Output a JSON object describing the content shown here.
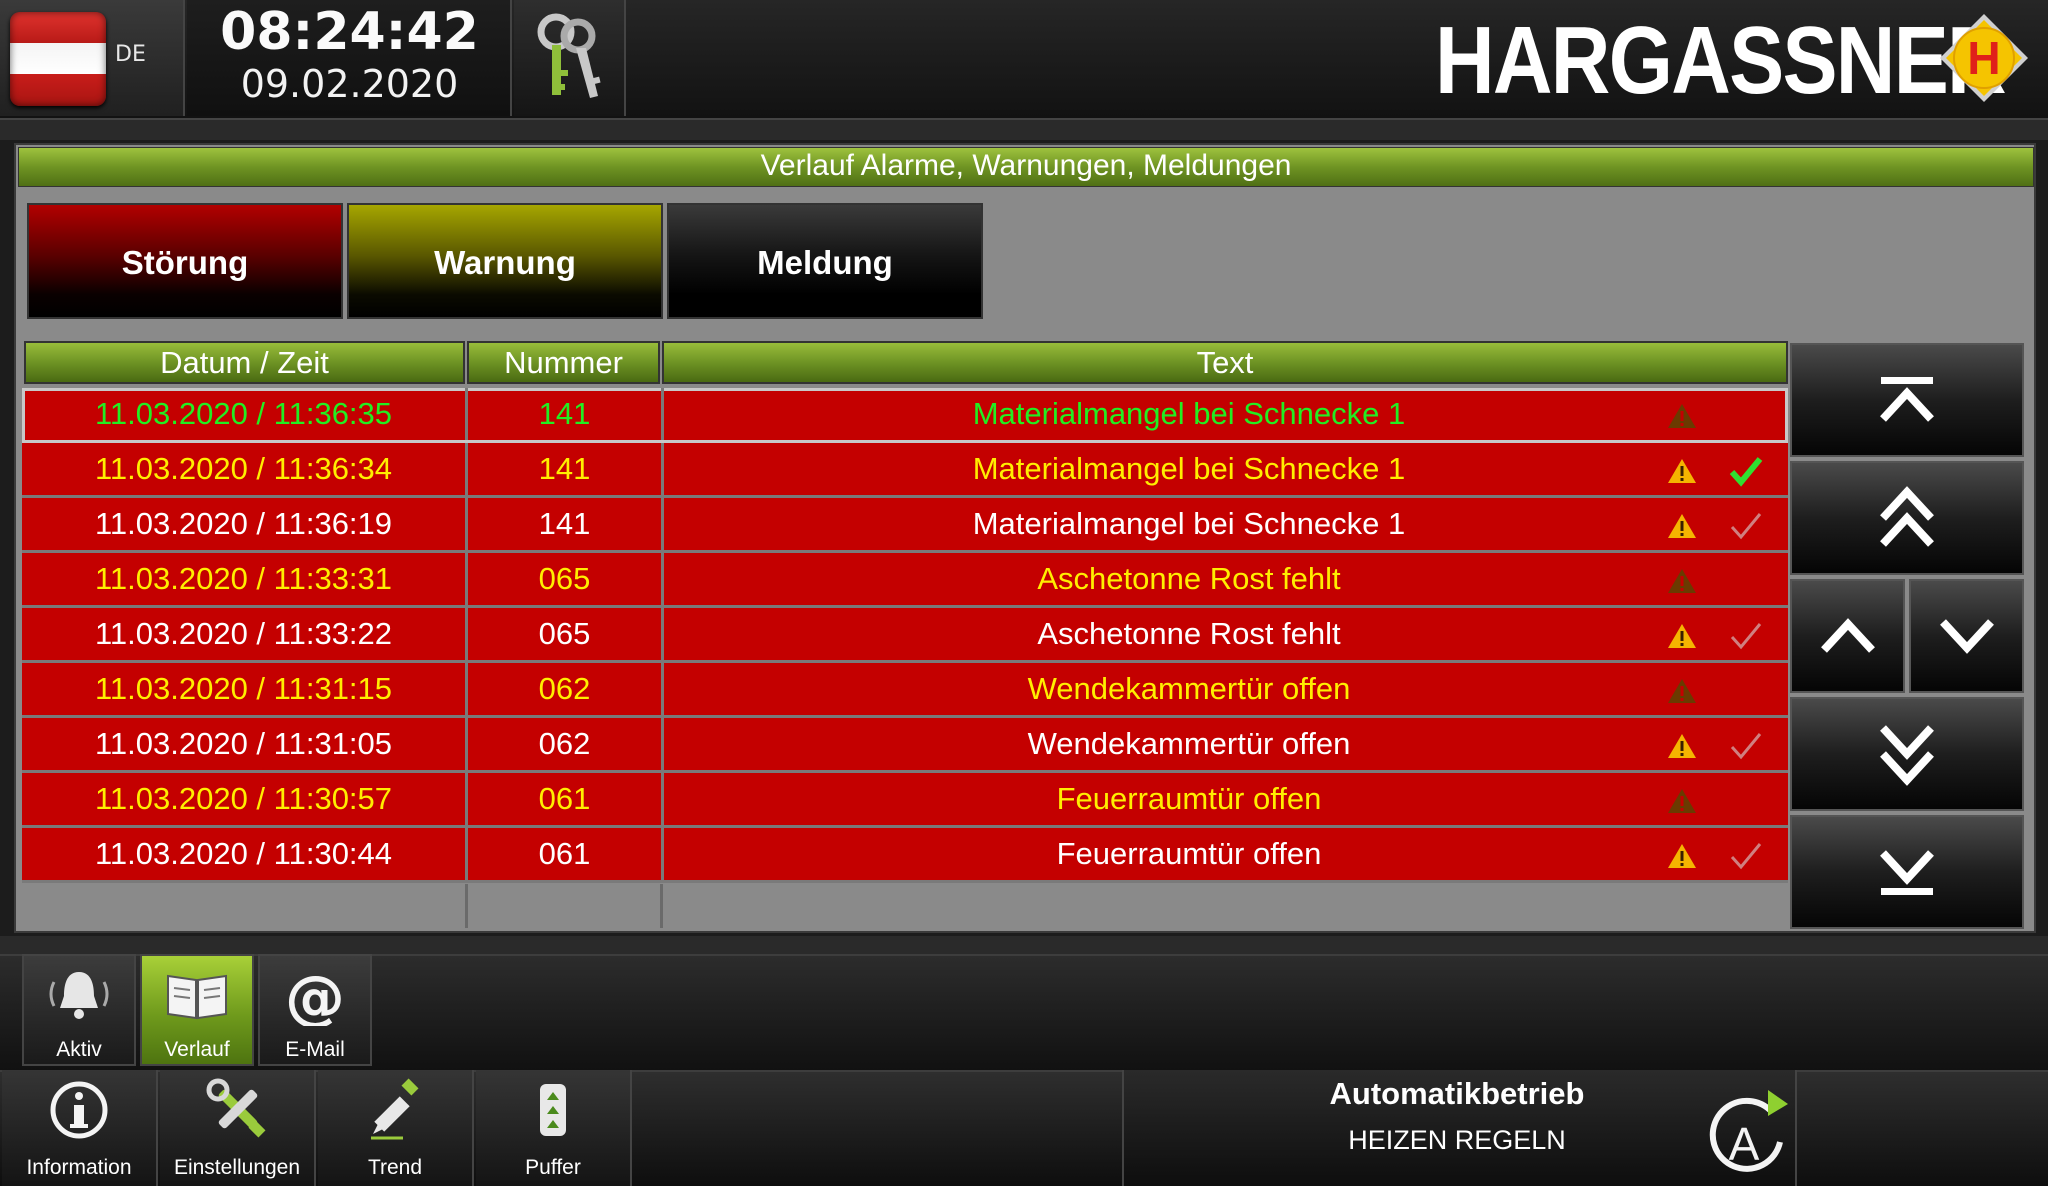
{
  "header": {
    "language": "DE",
    "time": "08:24:42",
    "date": "09.02.2020",
    "brand": "HARGASSNER",
    "brand_logo_letter": "H",
    "colors": {
      "brand_yellow": "#f5c400",
      "brand_red": "#e0201a"
    }
  },
  "panel": {
    "title": "Verlauf Alarme, Warnungen, Meldungen",
    "filters": [
      {
        "label": "Störung",
        "color": "#b20000"
      },
      {
        "label": "Warnung",
        "color": "#a6a600"
      },
      {
        "label": "Meldung",
        "color": "#111111"
      }
    ]
  },
  "table": {
    "columns": [
      "Datum / Zeit",
      "Nummer",
      "Text"
    ],
    "rows": [
      {
        "datetime": "11.03.2020  /  11:36:35",
        "number": "141",
        "text": "Materialmangel bei Schnecke 1",
        "text_color": "#22ee22",
        "warning_icon": "warning-dim",
        "check_icon": ""
      },
      {
        "datetime": "11.03.2020  /  11:36:34",
        "number": "141",
        "text": "Materialmangel bei Schnecke 1",
        "text_color": "#ffee00",
        "warning_icon": "warning",
        "check_icon": "check-green"
      },
      {
        "datetime": "11.03.2020  /  11:36:19",
        "number": "141",
        "text": "Materialmangel bei Schnecke 1",
        "text_color": "#ffffff",
        "warning_icon": "warning",
        "check_icon": "check-grey"
      },
      {
        "datetime": "11.03.2020  /  11:33:31",
        "number": "065",
        "text": "Aschetonne Rost fehlt",
        "text_color": "#ffee00",
        "warning_icon": "warning-dim",
        "check_icon": ""
      },
      {
        "datetime": "11.03.2020  /  11:33:22",
        "number": "065",
        "text": "Aschetonne Rost fehlt",
        "text_color": "#ffffff",
        "warning_icon": "warning",
        "check_icon": "check-grey"
      },
      {
        "datetime": "11.03.2020  /  11:31:15",
        "number": "062",
        "text": "Wendekammertür offen",
        "text_color": "#ffee00",
        "warning_icon": "warning-dim",
        "check_icon": ""
      },
      {
        "datetime": "11.03.2020  /  11:31:05",
        "number": "062",
        "text": "Wendekammertür offen",
        "text_color": "#ffffff",
        "warning_icon": "warning",
        "check_icon": "check-grey"
      },
      {
        "datetime": "11.03.2020  /  11:30:57",
        "number": "061",
        "text": "Feuerraumtür offen",
        "text_color": "#ffee00",
        "warning_icon": "warning-dim",
        "check_icon": ""
      },
      {
        "datetime": "11.03.2020  /  11:30:44",
        "number": "061",
        "text": "Feuerraumtür offen",
        "text_color": "#ffffff",
        "warning_icon": "warning",
        "check_icon": "check-grey"
      }
    ]
  },
  "scroll_buttons": [
    "scroll-top-icon",
    "page-up-icon",
    "line-up-icon",
    "line-down-icon",
    "page-down-icon",
    "scroll-bottom-icon"
  ],
  "subnav": [
    {
      "label": "Aktiv",
      "icon": "bell-icon",
      "active": false
    },
    {
      "label": "Verlauf",
      "icon": "book-icon",
      "active": true
    },
    {
      "label": "E-Mail",
      "icon": "at-icon",
      "active": false
    }
  ],
  "mainnav": [
    {
      "label": "Information",
      "icon": "info-icon"
    },
    {
      "label": "Einstellungen",
      "icon": "tools-icon"
    },
    {
      "label": "Trend",
      "icon": "pen-icon"
    },
    {
      "label": "Puffer",
      "icon": "buffer-tank-icon"
    }
  ],
  "status": {
    "mode": "Automatikbetrieb",
    "sub": "HEIZEN REGELN",
    "mode_icon_letter": "A"
  }
}
